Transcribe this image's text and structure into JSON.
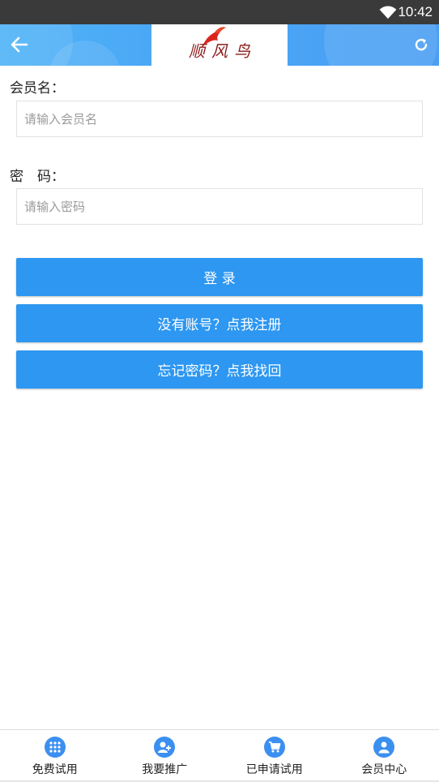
{
  "status_bar": {
    "time": "10:42",
    "wifi_icon": "wifi-icon"
  },
  "header": {
    "back_icon": "arrow-left-icon",
    "refresh_icon": "refresh-icon",
    "logo_text": "顺风鸟",
    "colors": {
      "header_bg": "#4aa6f5",
      "logo_red": "#d9261c"
    }
  },
  "form": {
    "username_label": "会员名：",
    "username_placeholder": "请输入会员名",
    "username_value": "",
    "password_label": "密　码：",
    "password_placeholder": "请输入密码",
    "password_value": ""
  },
  "buttons": {
    "login": "登 录",
    "register": "没有账号？点我注册",
    "forgot": "忘记密码？点我找回",
    "color": "#2d97f1"
  },
  "tabbar": {
    "items": [
      {
        "label": "免费试用",
        "icon": "grid-icon"
      },
      {
        "label": "我要推广",
        "icon": "add-user-icon"
      },
      {
        "label": "已申请试用",
        "icon": "cart-icon"
      },
      {
        "label": "会员中心",
        "icon": "user-icon"
      }
    ],
    "icon_color": "#3b8ff0"
  }
}
